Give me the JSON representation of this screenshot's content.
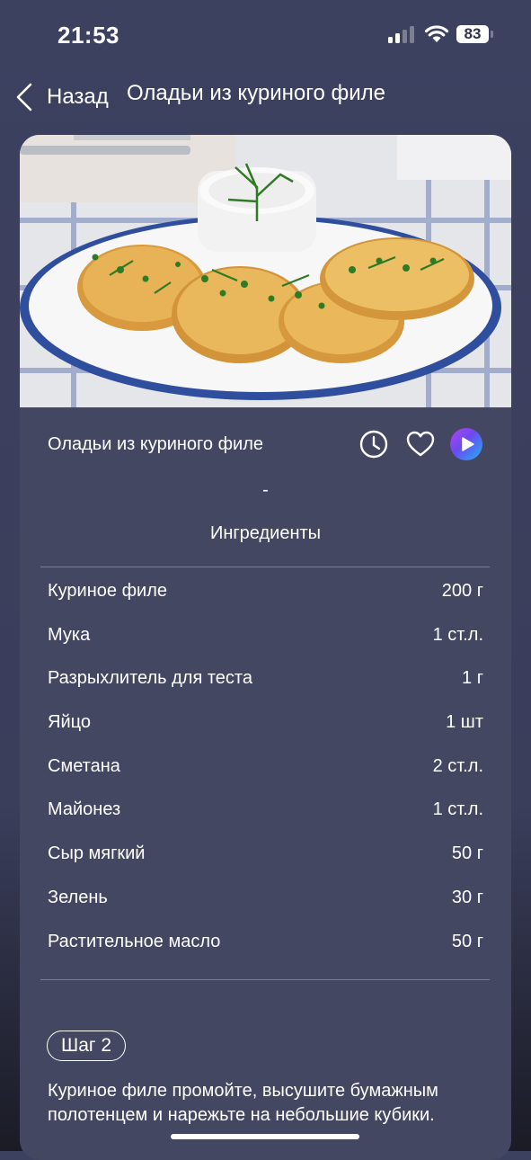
{
  "status": {
    "time": "21:53",
    "battery": "83"
  },
  "nav": {
    "back_label": "Назад",
    "title": "Оладьи из куриного филе"
  },
  "recipe": {
    "name": "Оладьи из куриного филе",
    "dash": "-",
    "icons": [
      "clock-icon",
      "heart-icon",
      "play-icon"
    ]
  },
  "ingredients": {
    "title": "Ингредиенты",
    "items": [
      {
        "name": "Куриное филе",
        "qty": "200 г"
      },
      {
        "name": "Мука",
        "qty": "1 ст.л."
      },
      {
        "name": "Разрыхлитель для теста",
        "qty": "1 г"
      },
      {
        "name": "Яйцо",
        "qty": "1 шт"
      },
      {
        "name": "Сметана",
        "qty": "2 ст.л."
      },
      {
        "name": "Майонез",
        "qty": "1 ст.л."
      },
      {
        "name": "Сыр мягкий",
        "qty": "50 г"
      },
      {
        "name": "Зелень",
        "qty": "30 г"
      },
      {
        "name": "Растительное масло",
        "qty": "50 г"
      }
    ]
  },
  "step": {
    "label": "Шаг 2",
    "text": "Куриное филе промойте, высушите бумажным полотенцем и нарежьте на небольшие кубики."
  },
  "colors": {
    "background": "#3d4160",
    "card": "#444762",
    "accent_play_start": "#b342f0",
    "accent_play_end": "#1fb1f5"
  }
}
